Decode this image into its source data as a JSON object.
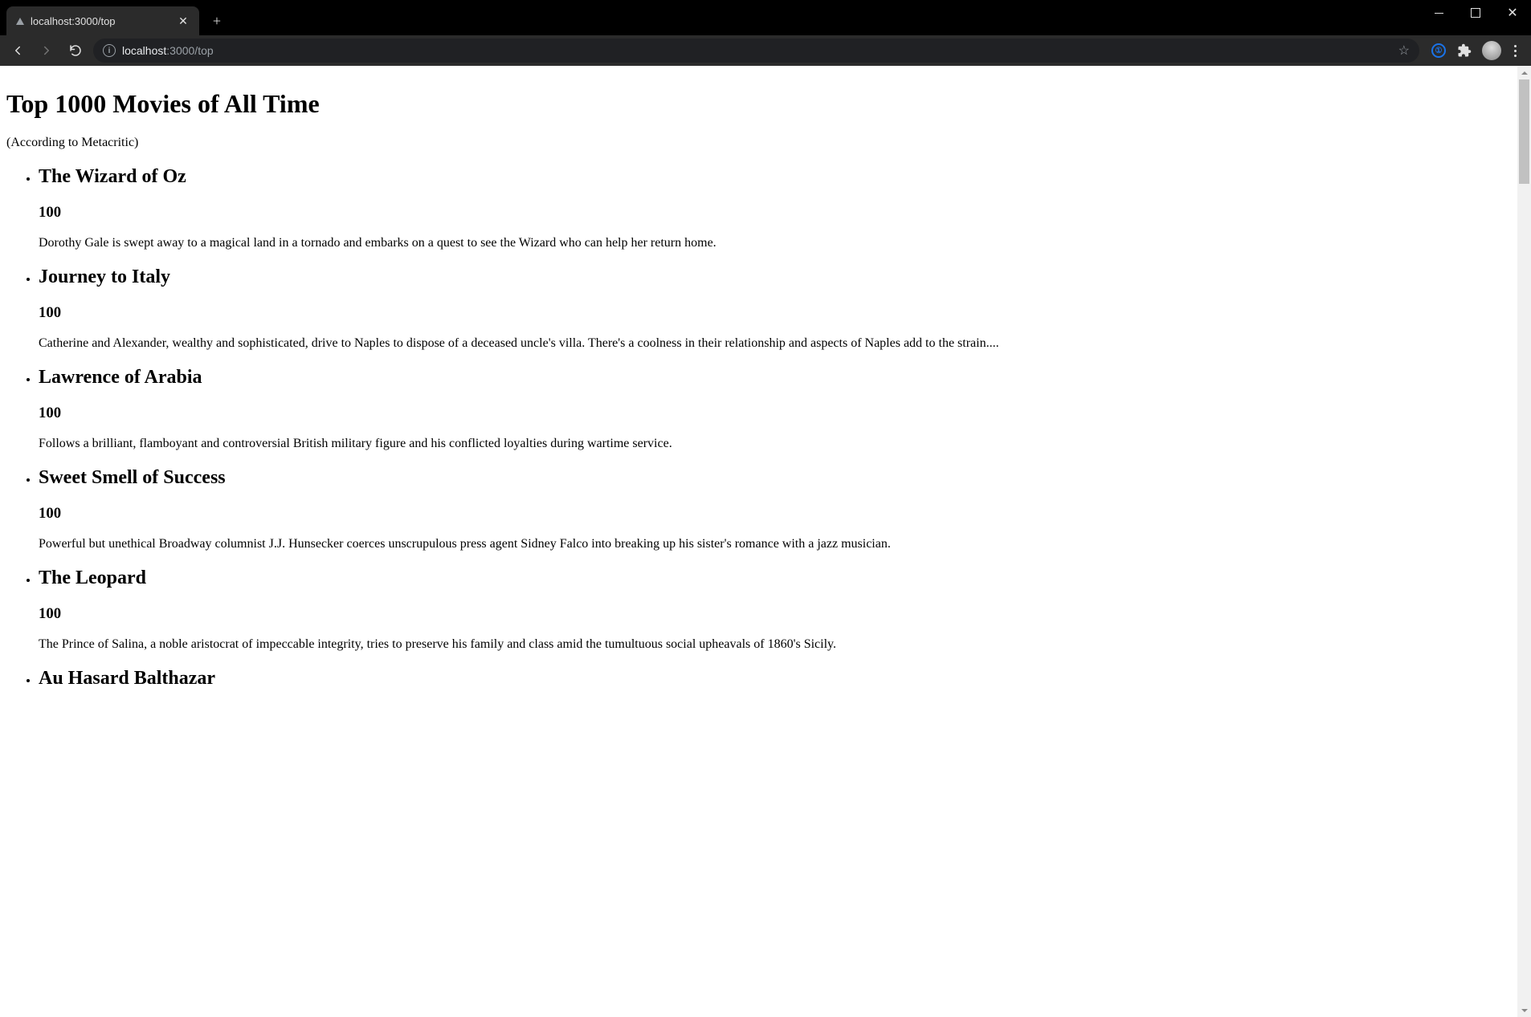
{
  "browser": {
    "tab_title": "localhost:3000/top",
    "url_host": "localhost",
    "url_port_path": ":3000/top"
  },
  "page": {
    "heading": "Top 1000 Movies of All Time",
    "subtitle": "(According to Metacritic)",
    "movies": [
      {
        "title": "The Wizard of Oz",
        "score": "100",
        "desc": "Dorothy Gale is swept away to a magical land in a tornado and embarks on a quest to see the Wizard who can help her return home."
      },
      {
        "title": "Journey to Italy",
        "score": "100",
        "desc": "Catherine and Alexander, wealthy and sophisticated, drive to Naples to dispose of a deceased uncle's villa. There's a coolness in their relationship and aspects of Naples add to the strain...."
      },
      {
        "title": "Lawrence of Arabia",
        "score": "100",
        "desc": "Follows a brilliant, flamboyant and controversial British military figure and his conflicted loyalties during wartime service."
      },
      {
        "title": "Sweet Smell of Success",
        "score": "100",
        "desc": "Powerful but unethical Broadway columnist J.J. Hunsecker coerces unscrupulous press agent Sidney Falco into breaking up his sister's romance with a jazz musician."
      },
      {
        "title": "The Leopard",
        "score": "100",
        "desc": "The Prince of Salina, a noble aristocrat of impeccable integrity, tries to preserve his family and class amid the tumultuous social upheavals of 1860's Sicily."
      },
      {
        "title": "Au Hasard Balthazar",
        "score": "",
        "desc": ""
      }
    ]
  }
}
